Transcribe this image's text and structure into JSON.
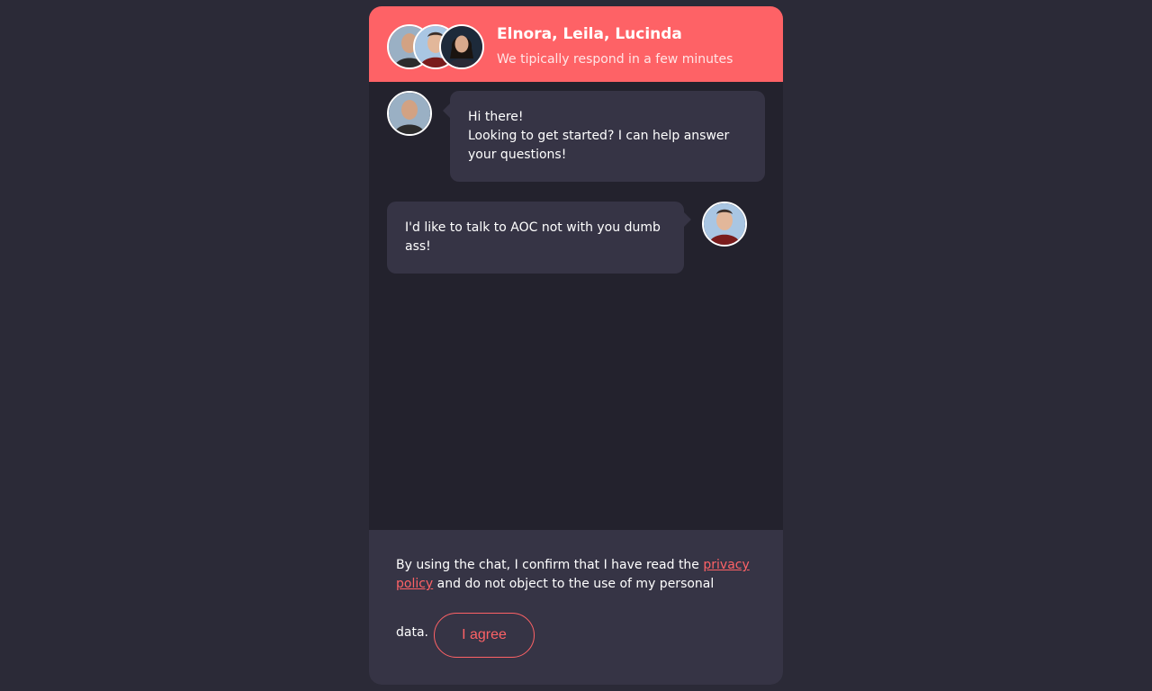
{
  "header": {
    "title": "Elnora, Leila, Lucinda",
    "subtitle": "We tipically respond in a few minutes",
    "avatars": [
      "agent-avatar-1",
      "agent-avatar-2",
      "agent-avatar-3"
    ]
  },
  "messages": [
    {
      "direction": "incoming",
      "lines": [
        "Hi there!",
        "Looking to get started? I can help answer your questions!"
      ]
    },
    {
      "direction": "outgoing",
      "lines": [
        "I'd like to talk to AOC not with you dumb ass!"
      ]
    }
  ],
  "consent": {
    "text_before": "By using the chat, I confirm that I have read the ",
    "link_label": "privacy policy",
    "text_after": " and do not object to the use of my personal",
    "text_end": "data.",
    "agree_label": "I agree"
  },
  "colors": {
    "accent": "#fe6266",
    "background": "#2b2a37",
    "panel": "#23222d",
    "bubble": "#363445"
  }
}
